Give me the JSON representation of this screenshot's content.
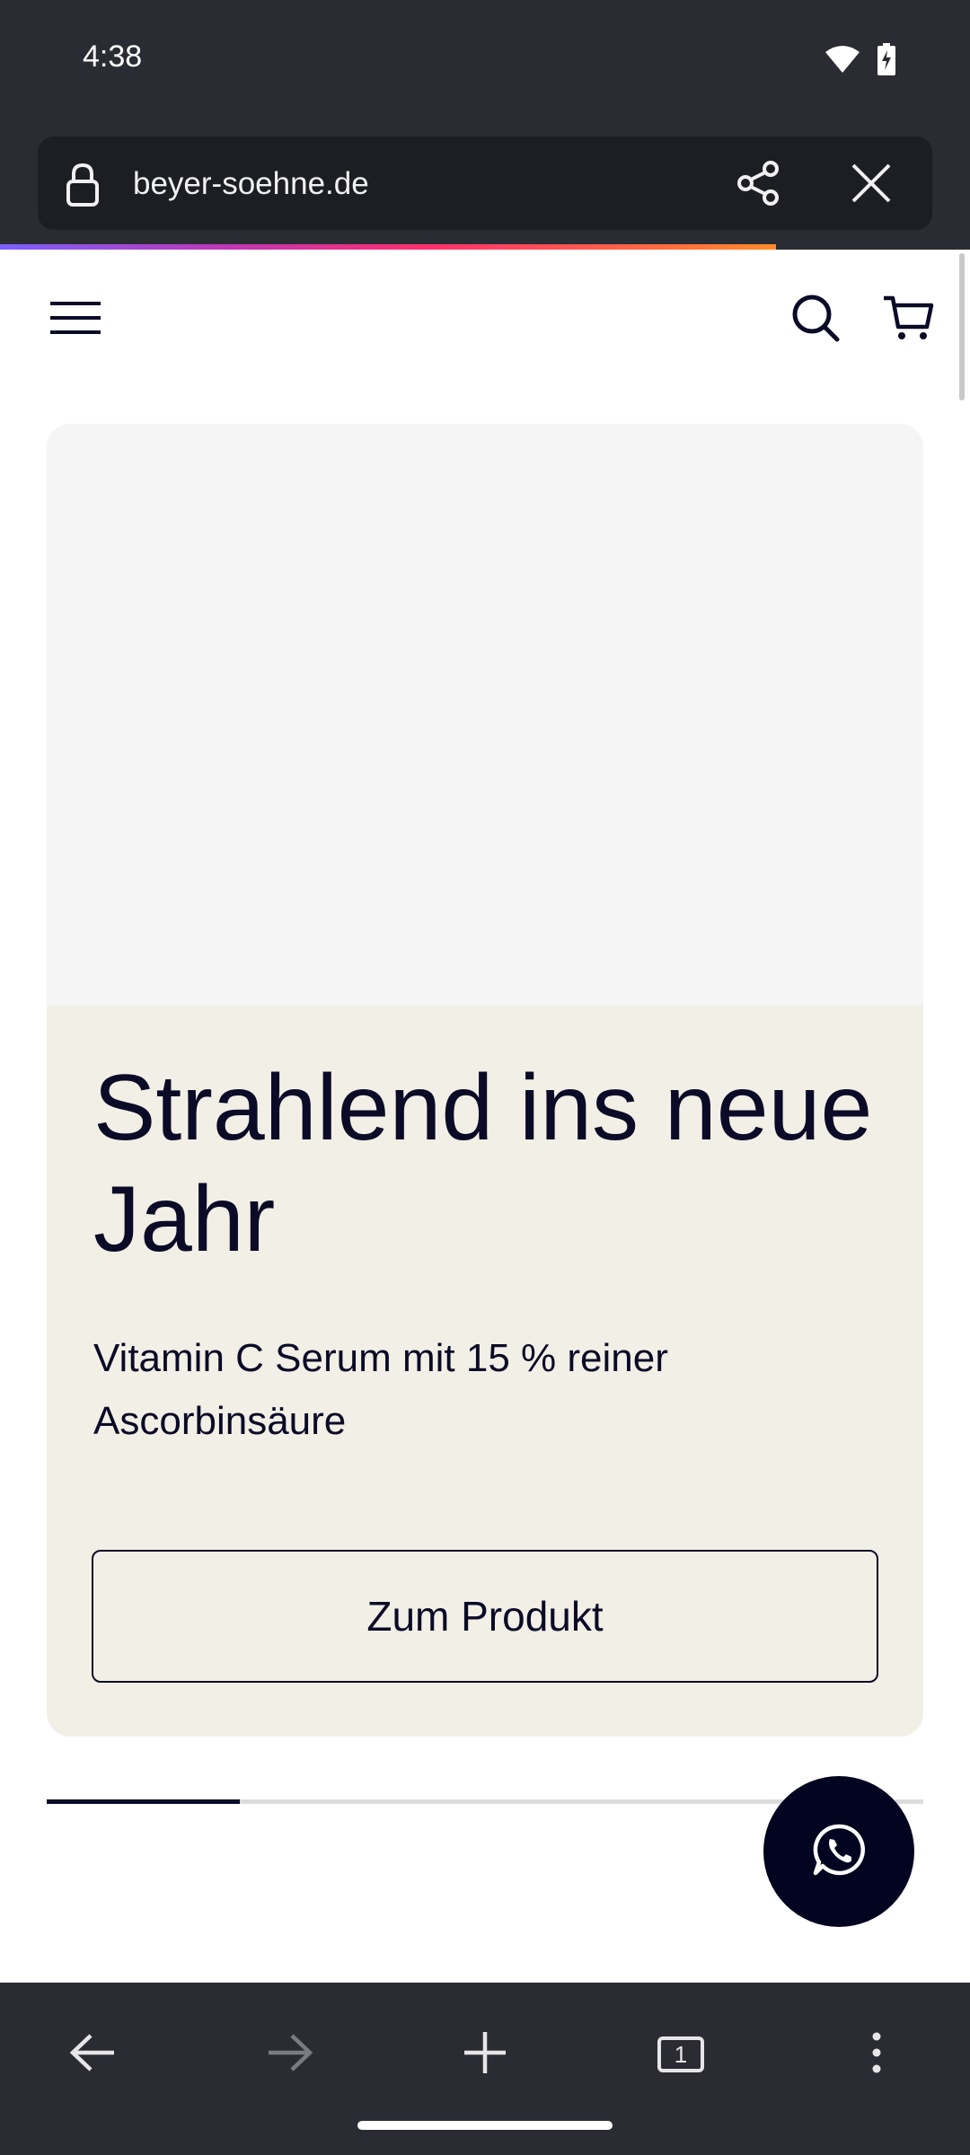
{
  "status_bar": {
    "time": "4:38",
    "icons": [
      "wifi-icon",
      "battery-charging-icon"
    ]
  },
  "browser": {
    "url": "beyer-soehne.de",
    "load_progress": 0.8,
    "toolbar_icons": [
      "lock-icon",
      "share-icon",
      "close-icon"
    ]
  },
  "site": {
    "header_icons": [
      "menu-icon",
      "search-icon",
      "cart-icon"
    ],
    "hero": {
      "title": "Strahlend ins neue Jahr",
      "subtitle": "Vitamin C Serum mit 15 % reiner Ascorbinsäure",
      "button_label": "Zum Produkt"
    },
    "slider_progress": 0.22,
    "fab_icon": "whatsapp-icon"
  },
  "bottom_nav": {
    "items": [
      "back-arrow-icon",
      "forward-arrow-icon",
      "new-tab-plus-icon",
      "tab-switcher-icon",
      "more-menu-icon"
    ],
    "tab_count": "1"
  },
  "colors": {
    "chrome_bg": "#2b2c33",
    "url_bg": "#1d1e23",
    "hero_bg": "#f2efe6",
    "hero_image_bg": "#f5f5f5",
    "text_dark": "#0b0b27",
    "fab_bg": "#03041f"
  }
}
